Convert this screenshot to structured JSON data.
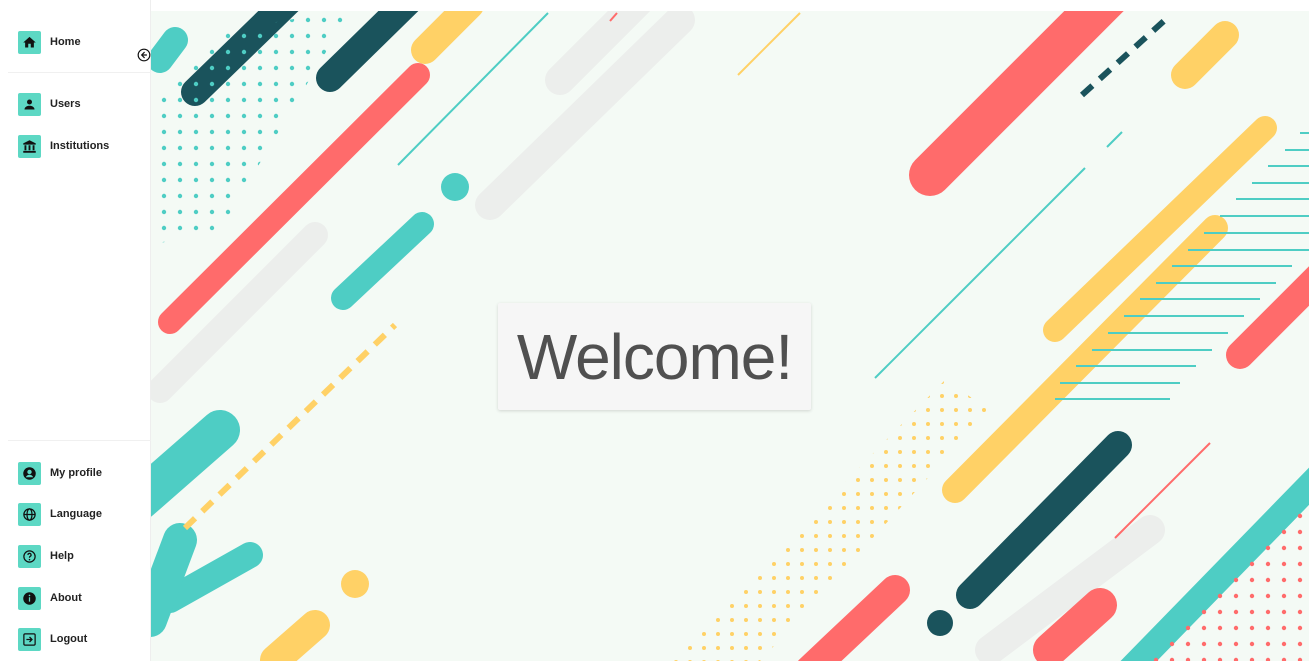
{
  "sidebar": {
    "top_items": [
      {
        "label": "Home",
        "icon": "home-icon"
      },
      {
        "label": "Users",
        "icon": "user-icon"
      },
      {
        "label": "Institutions",
        "icon": "institution-icon"
      }
    ],
    "bottom_items": [
      {
        "label": "My profile",
        "icon": "account-circle-icon"
      },
      {
        "label": "Language",
        "icon": "globe-icon"
      },
      {
        "label": "Help",
        "icon": "help-icon"
      },
      {
        "label": "About",
        "icon": "info-icon"
      },
      {
        "label": "Logout",
        "icon": "logout-icon"
      }
    ],
    "collapse_icon": "collapse-arrow-icon"
  },
  "main": {
    "welcome_text": "Welcome!"
  },
  "colors": {
    "teal": "#4ecdc4",
    "coral": "#ff6b6b",
    "yellow": "#ffd166",
    "dark_teal": "#1a535c",
    "background": "#f4faf5",
    "icon_bg": "#5dd8c4"
  }
}
